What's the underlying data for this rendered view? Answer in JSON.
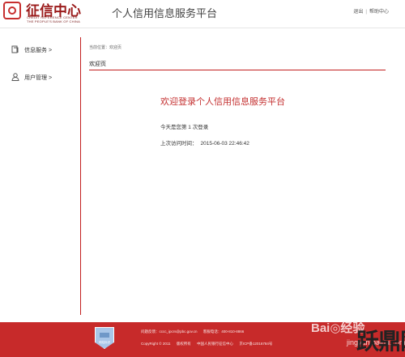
{
  "header": {
    "logo_cn": "征信中心",
    "logo_en_line1": "CREDIT REFERENCE CENTER",
    "logo_en_line2": "THE PEOPLE'S BANK OF CHINA",
    "site_title": "个人信用信息服务平台",
    "links": {
      "logout": "退出",
      "separator": "|",
      "help": "帮助中心"
    }
  },
  "sidebar": {
    "items": [
      {
        "label": "信息服务 >",
        "icon": "document-icon"
      },
      {
        "label": "用户管理 >",
        "icon": "user-icon"
      }
    ]
  },
  "main": {
    "breadcrumb": "当前位置：欢迎页",
    "panel_title": "欢迎页",
    "welcome": "欢迎登录个人信用信息服务平台",
    "login_count": "今天是您第 1 次登录",
    "last_visit_label": "上次访问时间：",
    "last_visit_value": "2015-06-03 22:46:42"
  },
  "footer": {
    "badge_text": "网站标识",
    "line1": [
      "问题反馈：cccc_ipcrs@pbc.gov.cn",
      "客服电话：400-810-8866"
    ],
    "line2": [
      "CopyRight © 2011",
      "版权所有",
      "中国人民银行征信中心",
      "京ICP备12016784号"
    ]
  },
  "watermark": {
    "baidu": "Bai◎经验",
    "url": "jingyan.baidu.com",
    "logo": "跃鼎网"
  },
  "colors": {
    "accent": "#c72a2a",
    "welcome_text": "#c43030"
  }
}
